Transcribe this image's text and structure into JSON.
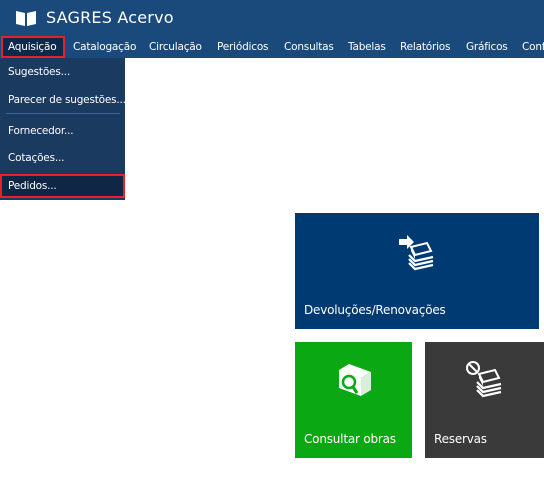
{
  "app": {
    "title": "SAGRES Acervo"
  },
  "menubar": {
    "items": [
      {
        "label": "Aquisição"
      },
      {
        "label": "Catalogação"
      },
      {
        "label": "Circulação"
      },
      {
        "label": "Periódicos"
      },
      {
        "label": "Consultas"
      },
      {
        "label": "Tabelas"
      },
      {
        "label": "Relatórios"
      },
      {
        "label": "Gráficos"
      },
      {
        "label": "Conf"
      }
    ]
  },
  "dropdown": {
    "items": [
      {
        "label": "Sugestões..."
      },
      {
        "label": "Parecer de sugestões..."
      },
      {
        "label": "Fornecedor..."
      },
      {
        "label": "Cotações..."
      },
      {
        "label": "Pedidos..."
      }
    ]
  },
  "tiles": {
    "devolucoes": {
      "label": "Devoluções/Renovações",
      "color": "#003a72"
    },
    "consultar": {
      "label": "Consultar obras",
      "color": "#0aa812"
    },
    "reservas": {
      "label": "Reservas",
      "color": "#3a3a3a"
    }
  },
  "colors": {
    "header": "#1a4a7c",
    "highlight_border": "#e8202a"
  }
}
